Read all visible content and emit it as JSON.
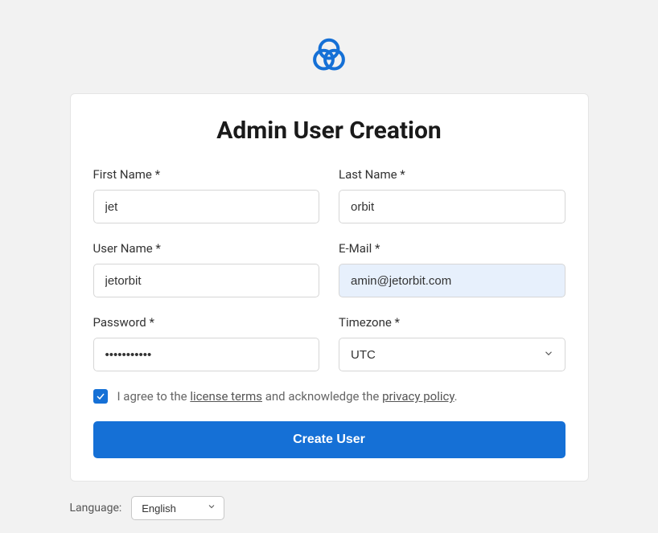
{
  "title": "Admin User Creation",
  "fields": {
    "first_name": {
      "label": "First Name *",
      "value": "jet"
    },
    "last_name": {
      "label": "Last Name *",
      "value": "orbit"
    },
    "user_name": {
      "label": "User Name *",
      "value": "jetorbit"
    },
    "email": {
      "label": "E-Mail *",
      "value": "amin@jetorbit.com"
    },
    "password": {
      "label": "Password *",
      "value": "•••••••••••"
    },
    "timezone": {
      "label": "Timezone *",
      "value": "UTC"
    }
  },
  "agree": {
    "checked": true,
    "text_prefix": "I agree to the ",
    "license_link": "license terms",
    "text_middle": " and acknowledge the ",
    "privacy_link": "privacy policy",
    "text_suffix": "."
  },
  "submit_label": "Create User",
  "language": {
    "label": "Language:",
    "value": "English"
  },
  "colors": {
    "primary": "#1570d6",
    "bg": "#f2f2f2",
    "card_bg": "#ffffff"
  }
}
